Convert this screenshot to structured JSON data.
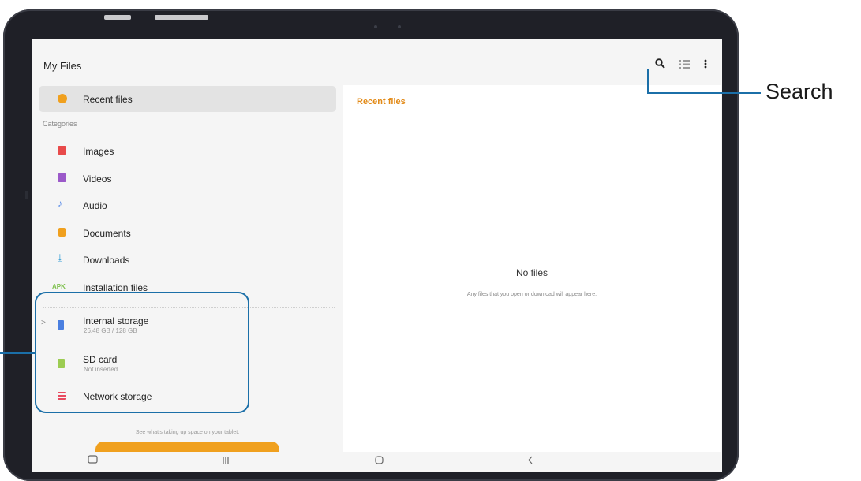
{
  "app": {
    "title": "My Files"
  },
  "toolbar": {
    "search_icon": "search-icon",
    "view_icon": "list-view-icon",
    "more_icon": "more-options-icon"
  },
  "sidebar": {
    "recent_label": "Recent files",
    "categories_header": "Categories",
    "categories": [
      {
        "label": "Images",
        "icon": "images-icon",
        "color": "#e84a4a"
      },
      {
        "label": "Videos",
        "icon": "videos-icon",
        "color": "#9b59c9"
      },
      {
        "label": "Audio",
        "icon": "audio-icon",
        "color": "#5c8ee8"
      },
      {
        "label": "Documents",
        "icon": "documents-icon",
        "color": "#f0a01e"
      },
      {
        "label": "Downloads",
        "icon": "downloads-icon",
        "color": "#3aa0d6"
      },
      {
        "label": "Installation files",
        "icon": "apk-icon",
        "badge": "APK",
        "color": "#7cbf4a"
      }
    ],
    "storage": [
      {
        "label": "Internal storage",
        "sub": "26.48 GB / 128 GB",
        "icon": "internal-storage-icon",
        "color": "#4a7fe0"
      },
      {
        "label": "SD card",
        "sub": "Not inserted",
        "icon": "sd-card-icon",
        "color": "#9ccc52"
      },
      {
        "label": "Network storage",
        "sub": "",
        "icon": "network-storage-icon",
        "color": "#e84a5f"
      }
    ],
    "footnote": "See what's taking up space on your tablet."
  },
  "main": {
    "title": "Recent files",
    "empty_title": "No files",
    "empty_sub": "Any files that you open or download will appear here."
  },
  "navbar": {
    "recents": "recent-apps-icon",
    "home": "home-icon",
    "back": "back-icon"
  },
  "callouts": {
    "search_label": "Search",
    "accent_color": "#1b6fa8"
  },
  "colors": {
    "accent": "#f0a01e",
    "device": "#1f2027"
  }
}
